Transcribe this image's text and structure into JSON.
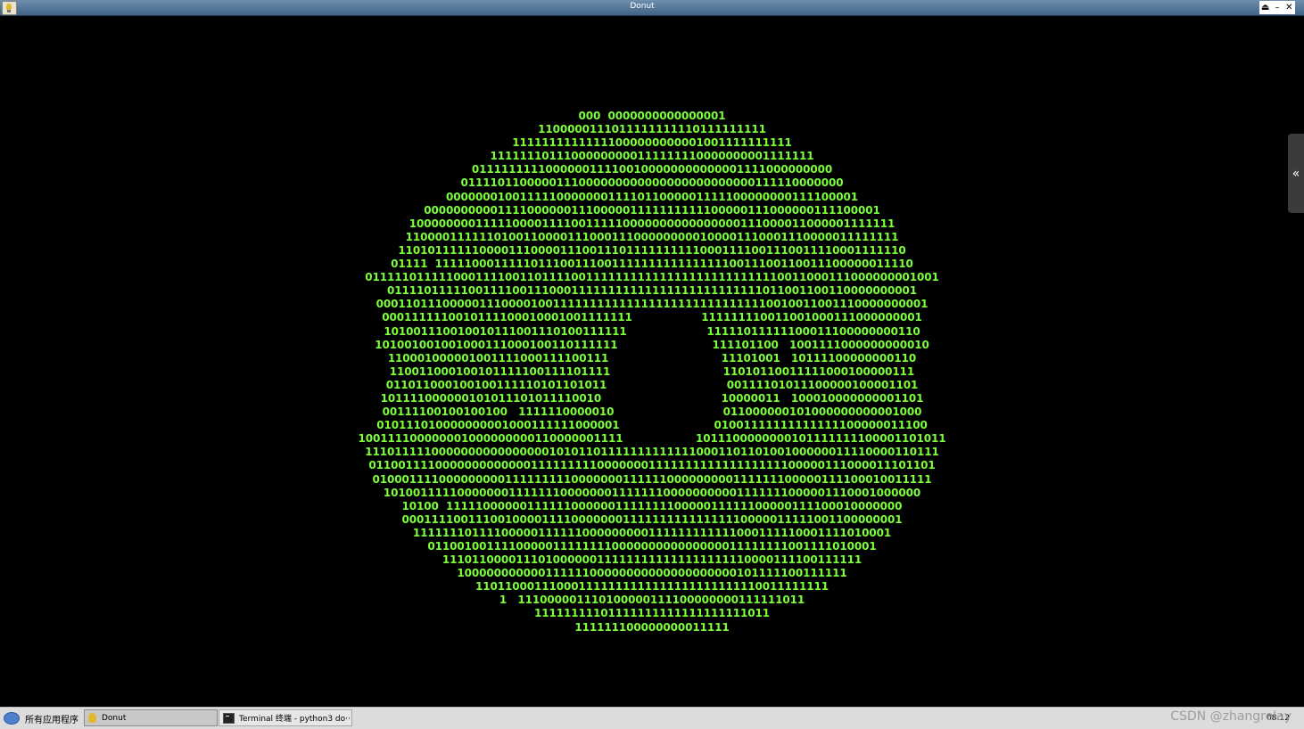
{
  "window": {
    "title": "Donut",
    "buttons": [
      "⏏",
      "–",
      "✕"
    ]
  },
  "side_tab": {
    "label": "«"
  },
  "donut_rows": [
    "000  0000000000000001",
    "1100000111011111111110111111111",
    "11111111111111000000000001001111111111",
    "11111110111000000000111111110000000001111111",
    "0111111111000000111100100000000000001111000000000",
    "0111101100000111000000000000000000000000111110000000",
    "00000001001111100000001111011000001111100000000111100001",
    "00000000001111000000111000001111111111100000111000000111100001",
    "100000000111110000111100111110000000000000000111000011000001111111",
    "1100001111110100110000111000111000000000100001110001110000011111111",
    "110101111110000111000011100111011111111110001111001110011110001111110",
    "01111  11111000111110111001110011111111111111110011100110011100000011110",
    "011111011111000111100110111100111111111111111111111111110011000111000000001001",
    "011110111110011110011100011111111111111111111111111011001100110000000001",
    "000110111000001110000100111111111111111111111111111110010011001110000000001",
    "0001111110010111100010001001111111                   111111110011001000111000000001",
    "101001110010010111001110100111111                      11111011111100011100000000110",
    "101001001001000111000100110111111                          111101100   1001111000000000010",
    "110001000001001111000111100111                               11101001   10111100000000110",
    "110011000100101111100111101111                               11010110011111000100000111",
    "011011000100100111110101101011                                 00111101011100000100001101",
    "101111000000101011101011110010                                 10000011   100010000000001101",
    "00111100100100100   1111110000010                              011000000101000000000001000",
    "010111010000000001000111111000001                          01001111111111111100000011100",
    "100111100000001000000000110000001111                    1011100000000101111111100001101011",
    "111011111000000000000000010101101111111111111000110110100100000011110000110111",
    "01100111100000000000001111111110000000111111111111111111100000111000011101101",
    "0100011110000000001111111110000000111111000000000111111100000111100010011111",
    "1010011111000000011111110000000111111100000000001111111000001110001000000",
    "10100  11111000000111111000000111111110000011111100000111100010000000",
    "00011110011100100001111000000011111111111111110000011111001100000001",
    "11111110111100000111111000000000111111111111000111110001111010001",
    "0110010011110000011111111000000000000000011111111001111010001",
    "111011000011101000000111111111111111111110000111100111111",
    "10000000000011111100000000000000000000101111100111111",
    "110110001110001111111111111111111111110011111111",
    "1   111000001110100000111100000000111111011",
    "11111111101111111111111111111011",
    "111111100000000011111"
  ],
  "taskbar": {
    "start_label": "所有应用程序",
    "tasks": [
      {
        "label": "Donut"
      },
      {
        "label": "Terminal 终端 - python3 do···"
      }
    ],
    "clock": "08:12"
  },
  "watermark": "CSDN @zhangrelay",
  "colors": {
    "donut": "#7cff3b",
    "background": "#000000",
    "titlebar": "#4f7396"
  }
}
